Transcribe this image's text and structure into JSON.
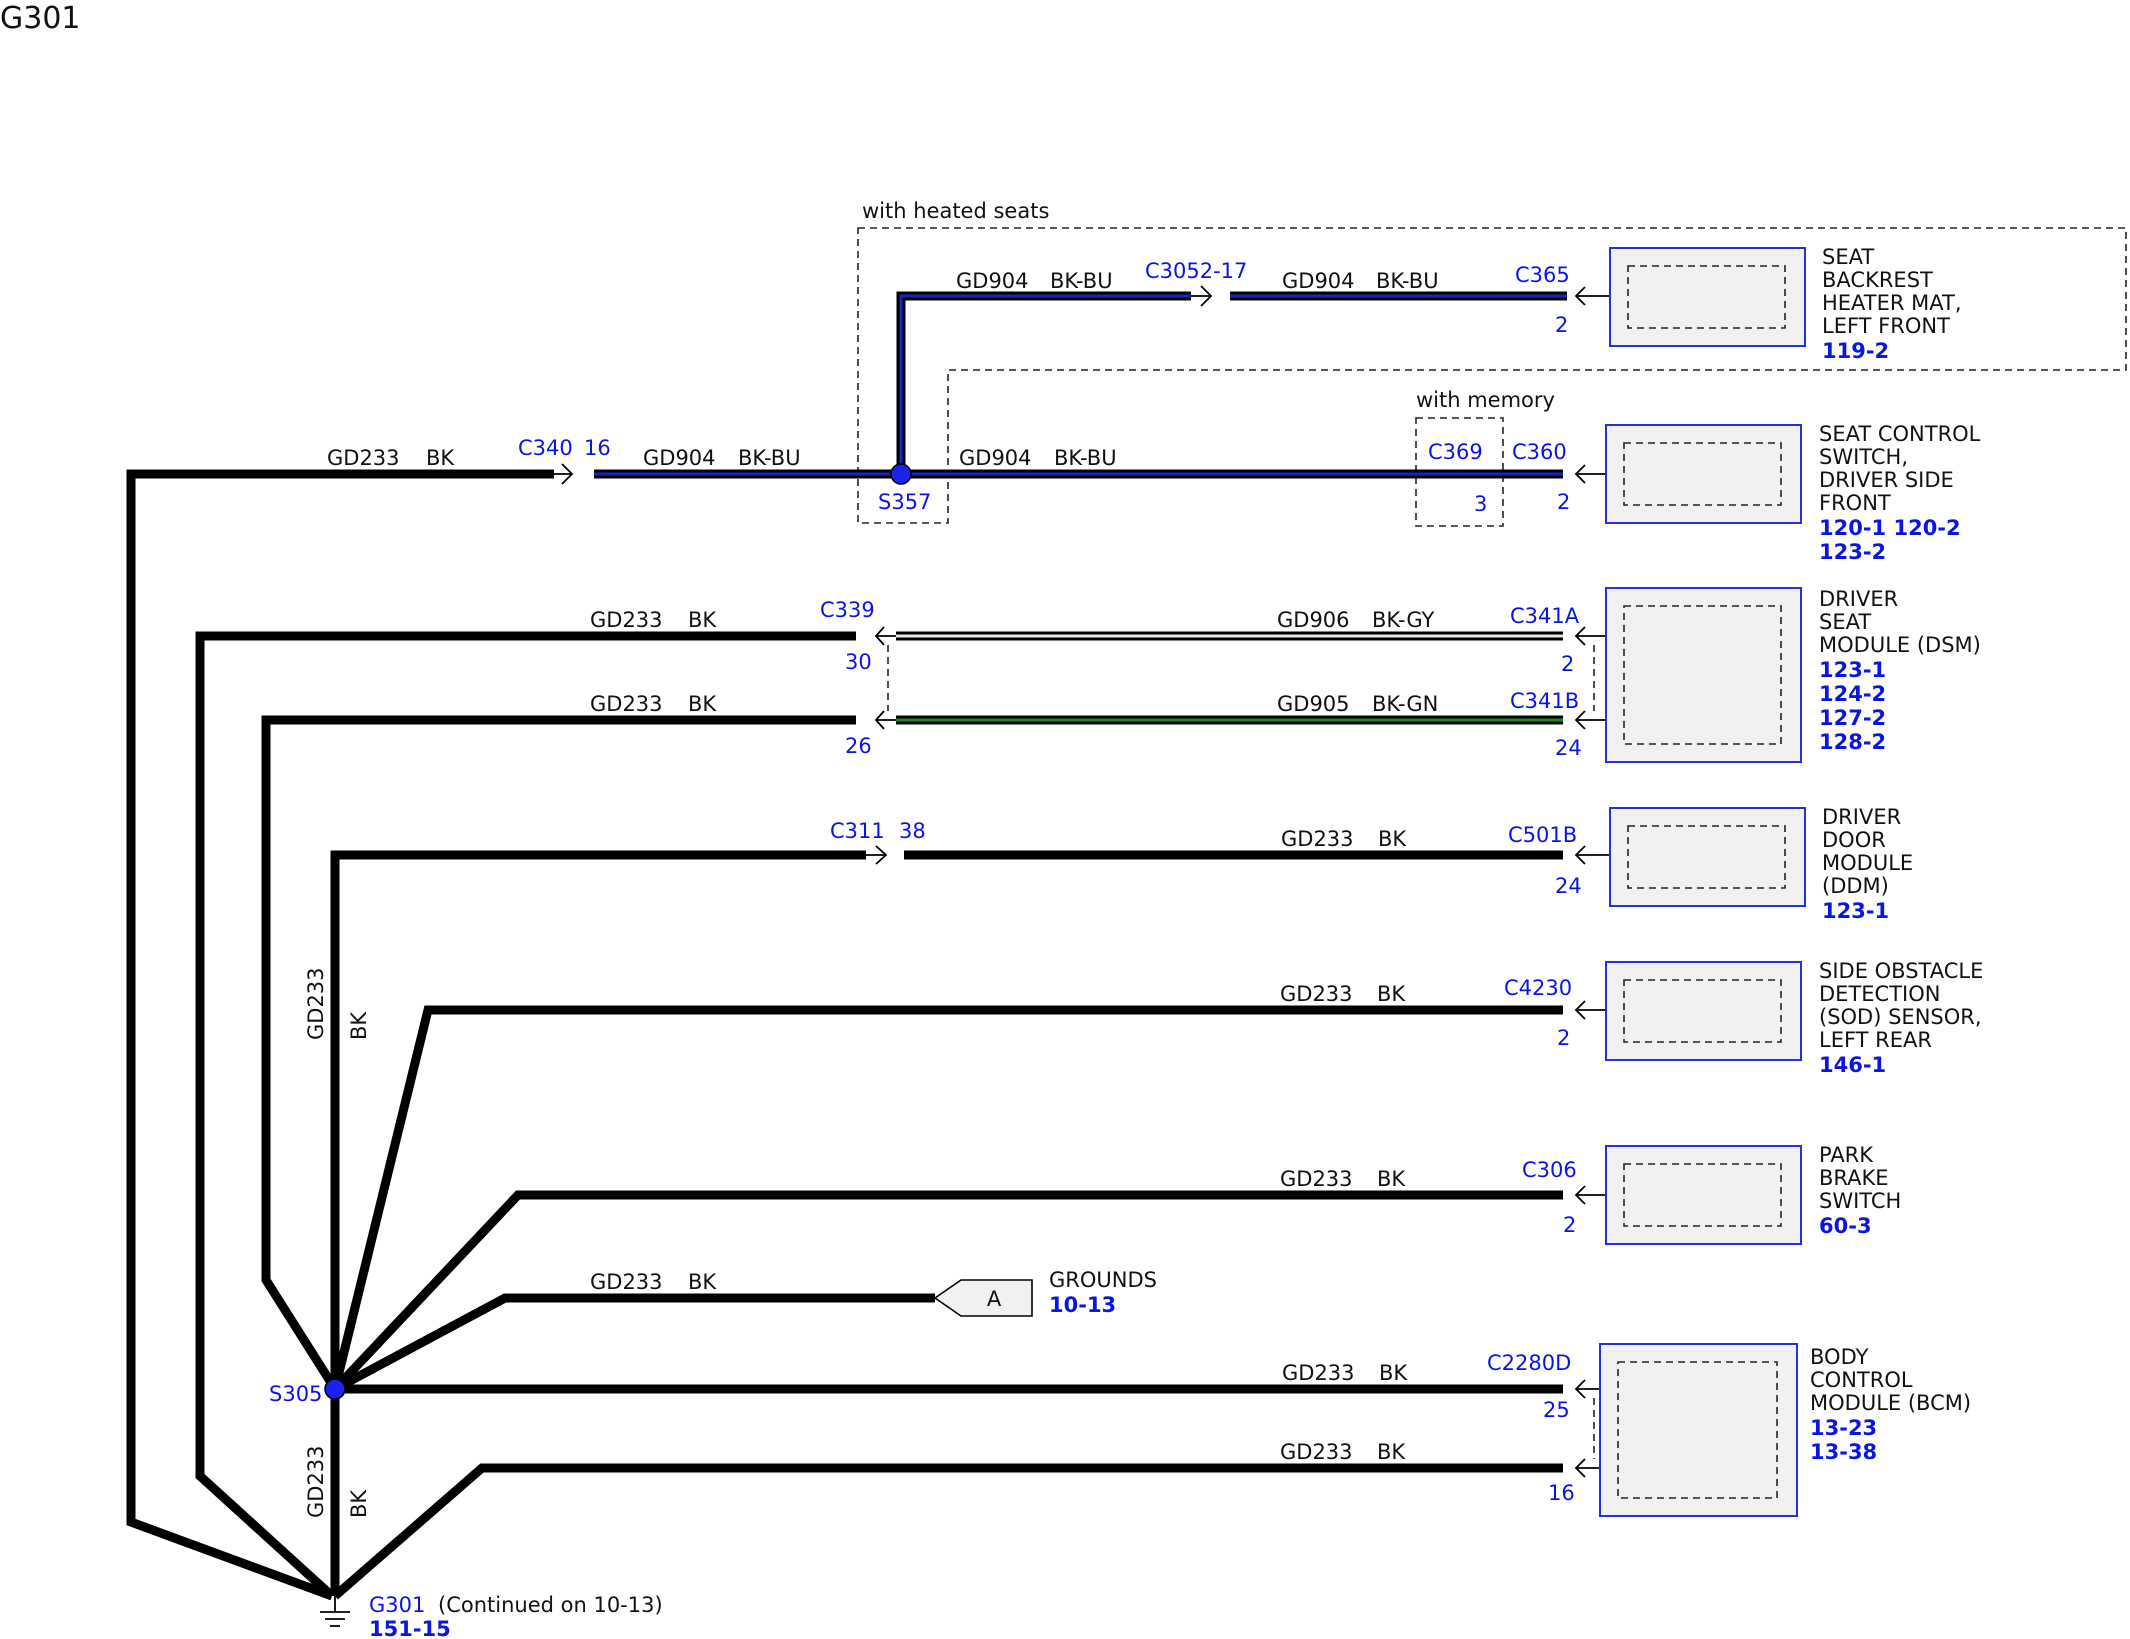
{
  "page_title": "G301",
  "option_labels": {
    "heated_seats": "with heated seats",
    "memory": "with memory"
  },
  "wire_labels": {
    "gd233": "GD233",
    "gd904": "GD904",
    "gd905": "GD905",
    "gd906": "GD906",
    "bk": "BK",
    "bk_bu": "BK-BU",
    "bk_gy": "BK-GY",
    "bk_gn": "BK-GN"
  },
  "connectors": {
    "c340": "C340",
    "c340_pin": "16",
    "c3052": "C3052-17",
    "c365": "C365",
    "c365_pin": "2",
    "c369": "C369",
    "c369_pin": "3",
    "c360": "C360",
    "c360_pin": "2",
    "c339": "C339",
    "c339_pin_top": "30",
    "c339_pin_bottom": "26",
    "c341a": "C341A",
    "c341a_pin": "2",
    "c341b": "C341B",
    "c341b_pin": "24",
    "c311": "C311",
    "c311_pin": "38",
    "c501b": "C501B",
    "c501b_pin": "24",
    "c4230": "C4230",
    "c4230_pin": "2",
    "c306": "C306",
    "c306_pin": "2",
    "c2280d": "C2280D",
    "c2280d_pin_top": "25",
    "c2280d_pin_bottom": "16"
  },
  "splices": {
    "s357": "S357",
    "s305": "S305"
  },
  "components": [
    {
      "lines": [
        "SEAT",
        "BACKREST",
        "HEATER MAT,",
        "LEFT FRONT"
      ],
      "refs": [
        "119-2"
      ]
    },
    {
      "lines": [
        "SEAT CONTROL",
        "SWITCH,",
        "DRIVER SIDE",
        "FRONT"
      ],
      "refs": [
        "120-1 120-2",
        "123-2"
      ]
    },
    {
      "lines": [
        "DRIVER",
        "SEAT",
        "MODULE (DSM)"
      ],
      "refs": [
        "123-1",
        "124-2",
        "127-2",
        "128-2"
      ]
    },
    {
      "lines": [
        "DRIVER",
        "DOOR",
        "MODULE",
        "(DDM)"
      ],
      "refs": [
        "123-1"
      ]
    },
    {
      "lines": [
        "SIDE OBSTACLE",
        "DETECTION",
        "(SOD) SENSOR,",
        "LEFT REAR"
      ],
      "refs": [
        "146-1"
      ]
    },
    {
      "lines": [
        "PARK",
        "BRAKE",
        "SWITCH"
      ],
      "refs": [
        "60-3"
      ]
    },
    {
      "lines": [
        "BODY",
        "CONTROL",
        "MODULE (BCM)"
      ],
      "refs": [
        "13-23",
        "13-38"
      ]
    }
  ],
  "grounds_ref": {
    "letter": "A",
    "label": "GROUNDS",
    "page": "10-13"
  },
  "ground_point": {
    "name": "G301",
    "note": "(Continued on 10-13)",
    "page": "151-15"
  },
  "colors": {
    "wire": "#000000",
    "blue_stripe": "#1a22c8",
    "green_stripe": "#1f8a1f",
    "gray_stripe": "#e6e6e6",
    "label_blue": "#0a16e0",
    "box_fill": "#f1f1f1"
  }
}
